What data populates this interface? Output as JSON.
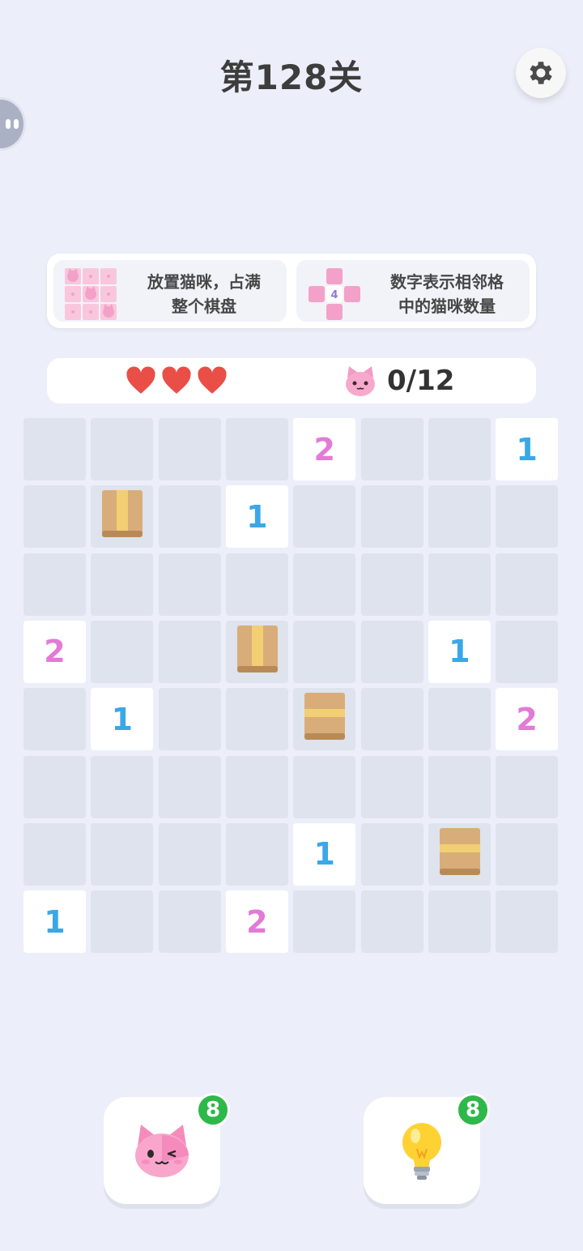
{
  "header": {
    "level_title": "第128关"
  },
  "rules": [
    {
      "line1": "放置猫咪，占满",
      "line2": "整个棋盘"
    },
    {
      "line1": "数字表示相邻格",
      "line2": "中的猫咪数量",
      "example_number": "4"
    }
  ],
  "status": {
    "lives": 3,
    "cat_count": "0/12"
  },
  "board": {
    "rows": 8,
    "cols": 8,
    "cells": [
      [
        "",
        "",
        "",
        "",
        "2",
        "",
        "",
        "1"
      ],
      [
        "",
        "box-v",
        "",
        "1",
        "",
        "",
        "",
        ""
      ],
      [
        "",
        "",
        "",
        "",
        "",
        "",
        "",
        ""
      ],
      [
        "2",
        "",
        "",
        "box-v",
        "",
        "",
        "1",
        ""
      ],
      [
        "",
        "1",
        "",
        "",
        "box-h",
        "",
        "",
        "2"
      ],
      [
        "",
        "",
        "",
        "",
        "",
        "",
        "",
        ""
      ],
      [
        "",
        "",
        "",
        "",
        "1",
        "",
        "box-h",
        ""
      ],
      [
        "1",
        "",
        "",
        "2",
        "",
        "",
        "",
        ""
      ]
    ]
  },
  "tools": {
    "cat_tool": {
      "badge": "8",
      "icon": "winking-cat-icon"
    },
    "hint_tool": {
      "badge": "8",
      "icon": "lightbulb-icon"
    }
  },
  "colors": {
    "number1": "#3aa8e8",
    "number2": "#e27ad6",
    "badge": "#2eb84a",
    "heart": "#e94e47"
  }
}
